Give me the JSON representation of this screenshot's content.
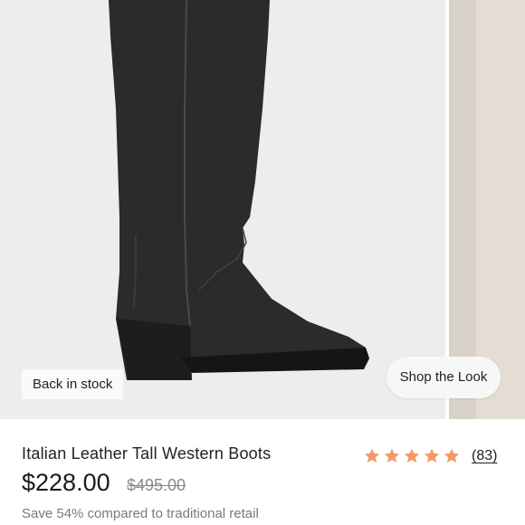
{
  "gallery": {
    "main_image_alt": "Black tall leather western boot",
    "badge": "Back in stock",
    "shop_look": "Shop the Look"
  },
  "product": {
    "title": "Italian Leather Tall Western Boots",
    "price": "$228.00",
    "compare_price": "$495.00",
    "savings": "Save 54% compared to traditional retail",
    "rating": {
      "stars": 5,
      "count": "(83)",
      "star_color": "#f29a6a"
    }
  },
  "colors": {
    "boot": "#262626",
    "background": "#ededec"
  }
}
